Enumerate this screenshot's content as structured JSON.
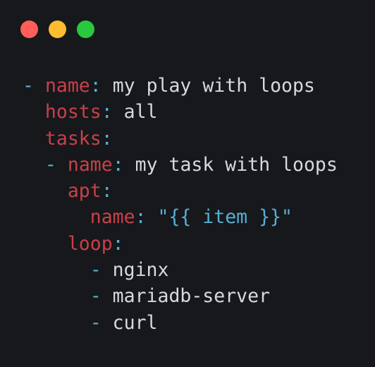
{
  "window": {
    "controls": [
      {
        "name": "close",
        "color": "#ff5f57"
      },
      {
        "name": "minimize",
        "color": "#febc2e"
      },
      {
        "name": "maximize",
        "color": "#28c840"
      }
    ]
  },
  "theme": {
    "background": "#16181b",
    "key_color": "#c9404a",
    "punctuation_color": "#56b0d6",
    "text_color": "#d7d9dc"
  },
  "code": {
    "language": "yaml",
    "lines": [
      {
        "indent": "",
        "dash": "-",
        "key": "name",
        "colon": ":",
        "value": "my play with loops",
        "value_type": "plain"
      },
      {
        "indent": "  ",
        "dash": "",
        "key": "hosts",
        "colon": ":",
        "value": "all",
        "value_type": "plain"
      },
      {
        "indent": "  ",
        "dash": "",
        "key": "tasks",
        "colon": ":",
        "value": "",
        "value_type": "plain"
      },
      {
        "indent": "  ",
        "dash": "-",
        "key": "name",
        "colon": ":",
        "value": "my task with loops",
        "value_type": "plain"
      },
      {
        "indent": "    ",
        "dash": "",
        "key": "apt",
        "colon": ":",
        "value": "",
        "value_type": "plain"
      },
      {
        "indent": "      ",
        "dash": "",
        "key": "name",
        "colon": ":",
        "value": "\"{{ item }}\"",
        "value_type": "string"
      },
      {
        "indent": "    ",
        "dash": "",
        "key": "loop",
        "colon": ":",
        "value": "",
        "value_type": "plain"
      },
      {
        "indent": "      ",
        "dash": "-",
        "key": "",
        "colon": "",
        "value": "nginx",
        "value_type": "plain"
      },
      {
        "indent": "      ",
        "dash": "-",
        "key": "",
        "colon": "",
        "value": "mariadb-server",
        "value_type": "plain"
      },
      {
        "indent": "      ",
        "dash": "-",
        "key": "",
        "colon": "",
        "value": "curl",
        "value_type": "plain"
      }
    ]
  }
}
